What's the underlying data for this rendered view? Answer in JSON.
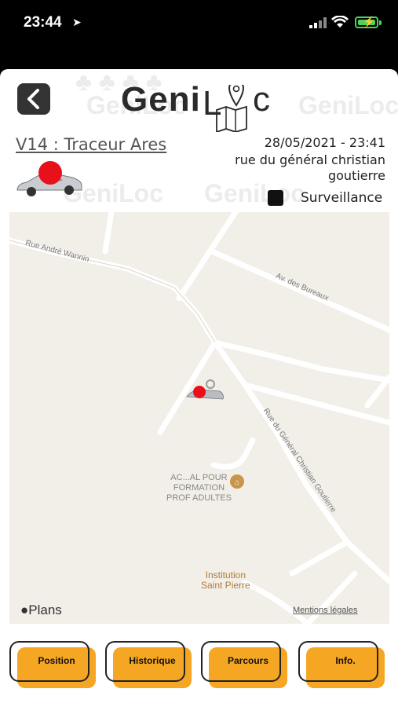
{
  "status_bar": {
    "time": "23:44"
  },
  "header": {
    "logo_left": "Geni",
    "logo_right": "c",
    "watermark_text": "GeniLoc"
  },
  "vehicle": {
    "title": "V14 : Traceur Ares",
    "datetime": "28/05/2021 - 23:41",
    "address": "rue du général christian goutierre",
    "surveillance_label": "Surveillance"
  },
  "map": {
    "streets": {
      "andre_wannin": "Rue André Wannin",
      "bureaux": "Av. des Bureaux",
      "goutierre": "Rue du Général Christian Goutierre"
    },
    "poi_afpa": "AC...AL POUR\nFORMATION\nPROF ADULTES",
    "poi_institution": "Institution\nSaint Pierre",
    "provider": "Plans",
    "legal": "Mentions légales"
  },
  "nav": {
    "position": "Position",
    "historique": "Historique",
    "parcours": "Parcours",
    "info": "Info."
  },
  "colors": {
    "accent": "#f5a623",
    "map_bg": "#f2efe9",
    "marker": "#e8111b"
  }
}
